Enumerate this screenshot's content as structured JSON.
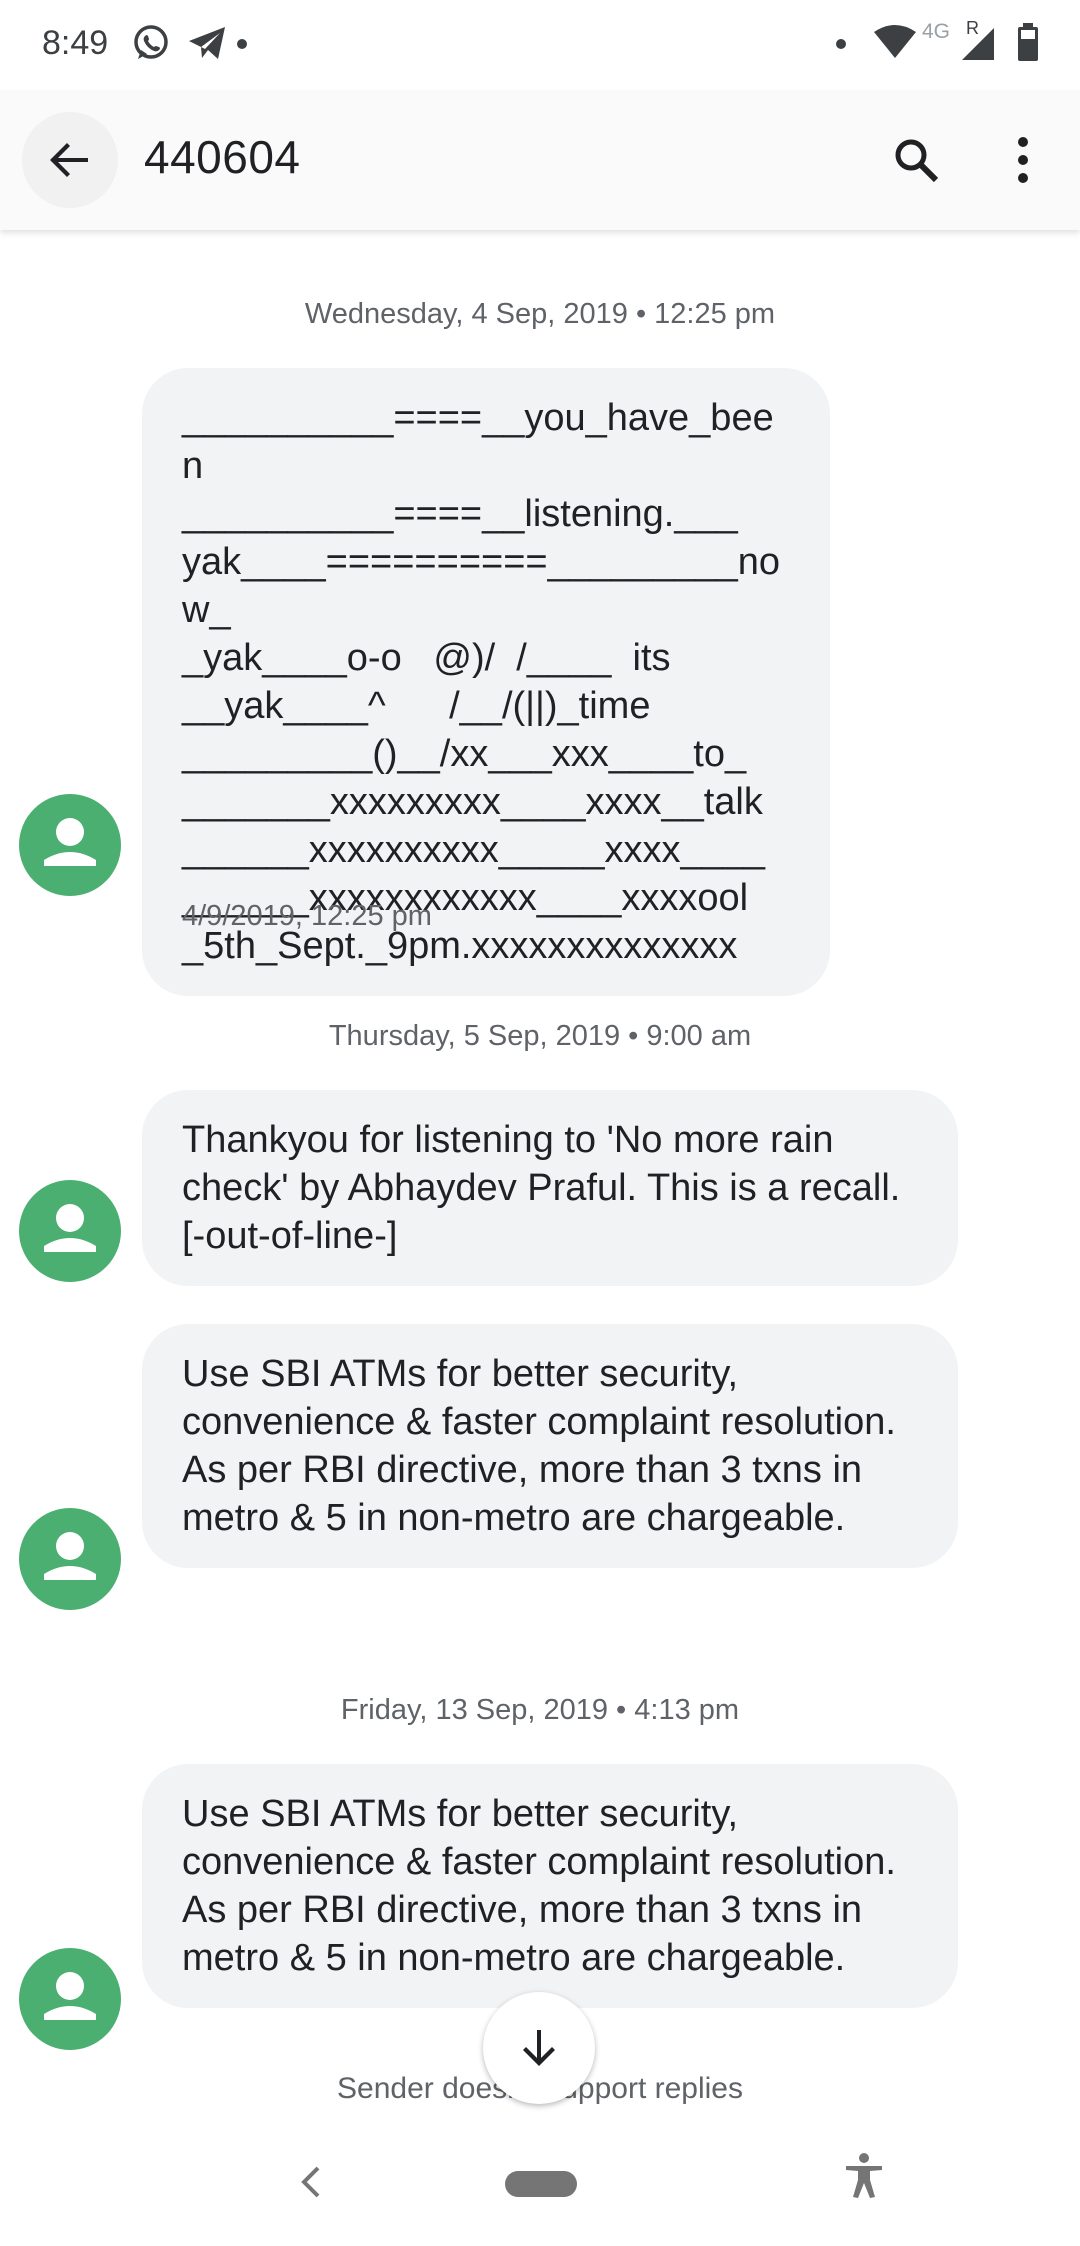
{
  "status_bar": {
    "time": "8:49",
    "network_label": "4G",
    "roaming_label": "R"
  },
  "toolbar": {
    "title": "440604"
  },
  "conversation": [
    {
      "date_header": "Wednesday, 4 Sep, 2019 • 12:25 pm",
      "message": "__________====__you_have_been\n__________====__listening.___\nyak____==========_________now_\n_yak____o-o   @)/  /____  its\n__yak____^      /__/(||)_time\n_________()__/xx___xxx____to_\n_______xxxxxxxxx____xxxx__talk\n______xxxxxxxxxx_____xxxx____\n______xxxxxxxxxxxx____xxxxool\n_5th_Sept._9pm.xxxxxxxxxxxxxx",
      "timestamp": "4/9/2019, 12:25 pm"
    },
    {
      "date_header": "Thursday, 5 Sep, 2019 • 9:00 am",
      "message": "Thankyou for listening to 'No more rain check' by Abhaydev Praful. This is a recall. [-out-of-line-]"
    },
    {
      "message": "Use SBI ATMs for better security, convenience & faster complaint resolution. As per RBI directive, more than 3 txns in metro & 5 in non-metro are chargeable."
    },
    {
      "date_header": "Friday, 13 Sep, 2019 • 4:13 pm",
      "message": "Use SBI ATMs for better security, convenience & faster complaint resolution. As per RBI directive, more than 3 txns in metro & 5 in non-metro are chargeable."
    }
  ],
  "footer": {
    "note": "Sender doesn't support replies"
  },
  "colors": {
    "avatar": "#4caf72",
    "bubble": "#f1f3f4",
    "secondary_text": "#5f6368"
  }
}
